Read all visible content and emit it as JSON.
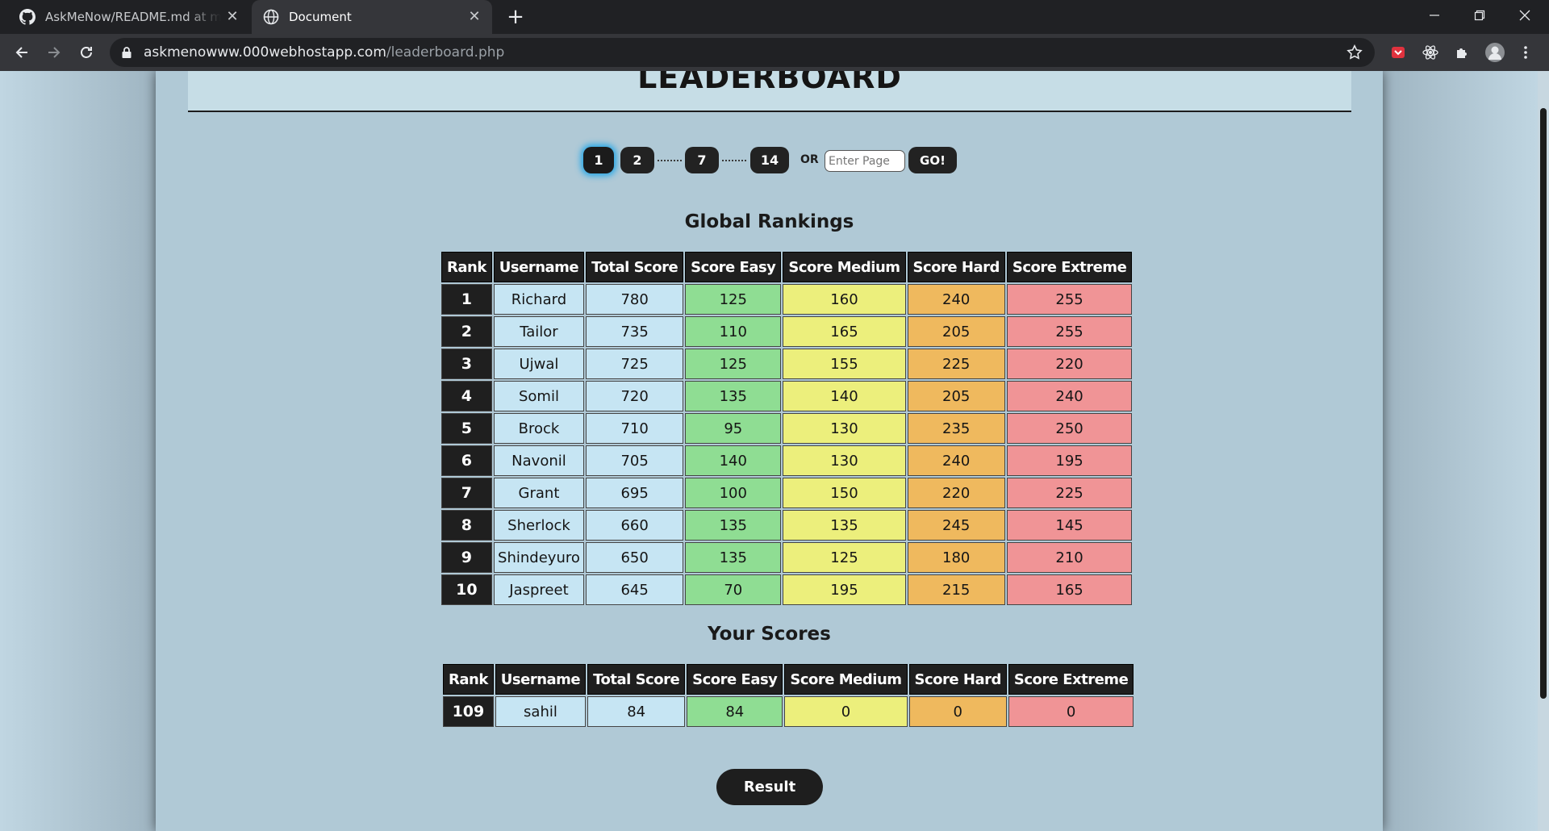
{
  "browser": {
    "tabs": [
      {
        "title": "AskMeNow/README.md at master",
        "icon": "github-icon"
      },
      {
        "title": "Document",
        "icon": "globe-icon"
      }
    ],
    "url": {
      "host": "askmenowww.000webhostapp.com",
      "path": "/leaderboard.php"
    }
  },
  "page": {
    "title": "LEADERBOARD",
    "pagination": {
      "pages": [
        "1",
        "2",
        "7",
        "14"
      ],
      "active": "1",
      "or_label": "OR",
      "input_placeholder": "Enter Page",
      "go_label": "GO!"
    },
    "global_title": "Global Rankings",
    "your_title": "Your Scores",
    "columns": [
      "Rank",
      "Username",
      "Total Score",
      "Score Easy",
      "Score Medium",
      "Score Hard",
      "Score Extreme"
    ],
    "global_rows": [
      [
        "1",
        "Richard",
        "780",
        "125",
        "160",
        "240",
        "255"
      ],
      [
        "2",
        "Tailor",
        "735",
        "110",
        "165",
        "205",
        "255"
      ],
      [
        "3",
        "Ujwal",
        "725",
        "125",
        "155",
        "225",
        "220"
      ],
      [
        "4",
        "Somil",
        "720",
        "135",
        "140",
        "205",
        "240"
      ],
      [
        "5",
        "Brock",
        "710",
        "95",
        "130",
        "235",
        "250"
      ],
      [
        "6",
        "Navonil",
        "705",
        "140",
        "130",
        "240",
        "195"
      ],
      [
        "7",
        "Grant",
        "695",
        "100",
        "150",
        "220",
        "225"
      ],
      [
        "8",
        "Sherlock",
        "660",
        "135",
        "135",
        "245",
        "145"
      ],
      [
        "9",
        "Shindeyuro",
        "650",
        "135",
        "125",
        "180",
        "210"
      ],
      [
        "10",
        "Jaspreet",
        "645",
        "70",
        "195",
        "215",
        "165"
      ]
    ],
    "your_rows": [
      [
        "109",
        "sahil",
        "84",
        "84",
        "0",
        "0",
        "0"
      ]
    ],
    "result_label": "Result",
    "colors": {
      "easy": "#8fdd93",
      "medium": "#ecef7c",
      "hard": "#efb95e",
      "extreme": "#f09496",
      "info": "#c6e5f3",
      "header": "#1f1f1f"
    }
  }
}
